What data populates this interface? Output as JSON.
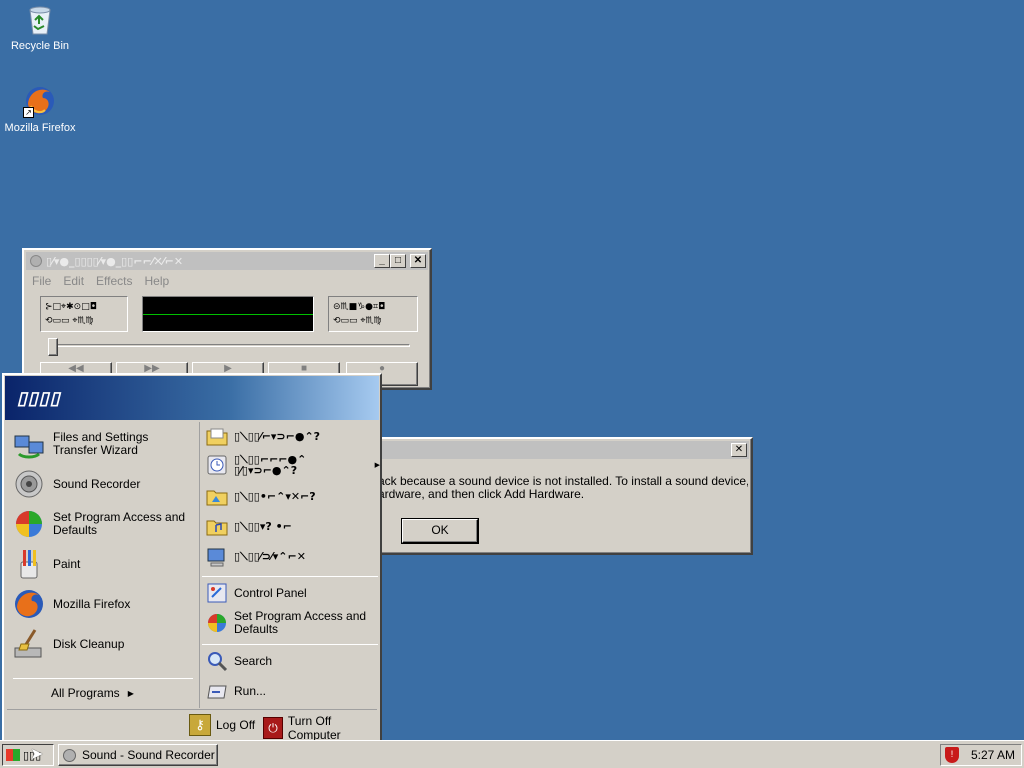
{
  "desktop": {
    "icons": [
      {
        "label": "Recycle Bin"
      },
      {
        "label": "Mozilla Firefox"
      }
    ]
  },
  "sound_recorder": {
    "title": "▯⁄▾●_▯▯▯▯⁄▾●_▯▯⌐⌐⁄✕⁄⌐✕",
    "menu": [
      "File",
      "Edit",
      "Effects",
      "Help"
    ],
    "position_label_1": "⊱□⌖✱⊙□◘",
    "position_label_2": "⟲▭▭  ⌖♏♍",
    "length_label_1": "⊝♏■♑●⌗◘",
    "length_label_2": "⟲▭▭  ⌖♏♍",
    "buttons": {
      "rewind": "◀◀",
      "forward": "▶▶",
      "play": "▶",
      "stop": "■",
      "record": "●"
    }
  },
  "error_dialog": {
    "message_line_1": "ack because a sound device is not installed. To install a sound device, go to",
    "message_line_2": "ardware, and then click Add Hardware.",
    "ok_label": "OK",
    "close_glyph": "✕"
  },
  "start_menu": {
    "header": "▯▯▯▯",
    "left_items": [
      {
        "label": "Files and Settings Transfer Wizard"
      },
      {
        "label": "Sound Recorder"
      },
      {
        "label": "Set Program Access and Defaults"
      },
      {
        "label": "Paint"
      },
      {
        "label": "Mozilla Firefox"
      },
      {
        "label": "Disk Cleanup"
      }
    ],
    "all_programs": "All Programs",
    "right_items": [
      {
        "label": "▯⟍▯▯⁄⌐▾⊃⌐●⌃?"
      },
      {
        "label": "▯⟍▯▯⌐⌐⌐●⌃",
        "label2": "▯⁄▯▾⊃⌐●⌃?"
      },
      {
        "label": "▯⟍▯▯•⌐⌃▾✕⌐?"
      },
      {
        "label": "▯⟍▯▯▾? •⌐"
      },
      {
        "label": "▯⟍▯▯⁄⊃⁄▾⌃⌐✕"
      },
      {
        "label": "Control Panel"
      },
      {
        "label": "Set Program Access and Defaults"
      },
      {
        "label": "Search"
      },
      {
        "label": "Run..."
      }
    ],
    "log_off": "Log Off",
    "turn_off": "Turn Off Computer"
  },
  "taskbar": {
    "start_label": "▯▯▯",
    "task_label": "Sound - Sound Recorder",
    "clock": "5:27 AM"
  }
}
